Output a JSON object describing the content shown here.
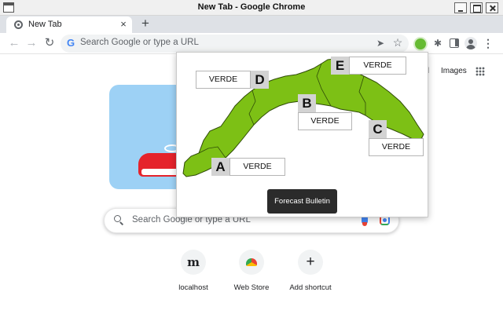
{
  "window": {
    "title": "New Tab - Google Chrome"
  },
  "tab": {
    "title": "New Tab",
    "close_glyph": "×",
    "new_tab_glyph": "+"
  },
  "toolbar": {
    "back_glyph": "←",
    "forward_glyph": "→",
    "reload_glyph": "↻",
    "omnibox_placeholder": "Search Google or type a URL",
    "omnibox_icon_glyph": "G",
    "send_glyph": "➤",
    "star_glyph": "☆",
    "puzzle_glyph": "✱",
    "menu_glyph": "⋮",
    "active_extension_color": "#66bb33"
  },
  "ntp": {
    "gmail": "ail",
    "images": "Images",
    "search_placeholder": "Search Google or type a URL",
    "shortcuts": [
      {
        "label": "localhost",
        "glyph": "m"
      },
      {
        "label": "Web Store",
        "glyph": ""
      },
      {
        "label": "Add shortcut",
        "glyph": "+"
      }
    ]
  },
  "popup": {
    "map_fill_color": "#7dc015",
    "zones": [
      {
        "letter": "A",
        "level": "VERDE"
      },
      {
        "letter": "B",
        "level": "VERDE"
      },
      {
        "letter": "C",
        "level": "VERDE"
      },
      {
        "letter": "D",
        "level": "VERDE"
      },
      {
        "letter": "E",
        "level": "VERDE"
      }
    ],
    "bulletin_button": "Forecast Bulletin"
  }
}
